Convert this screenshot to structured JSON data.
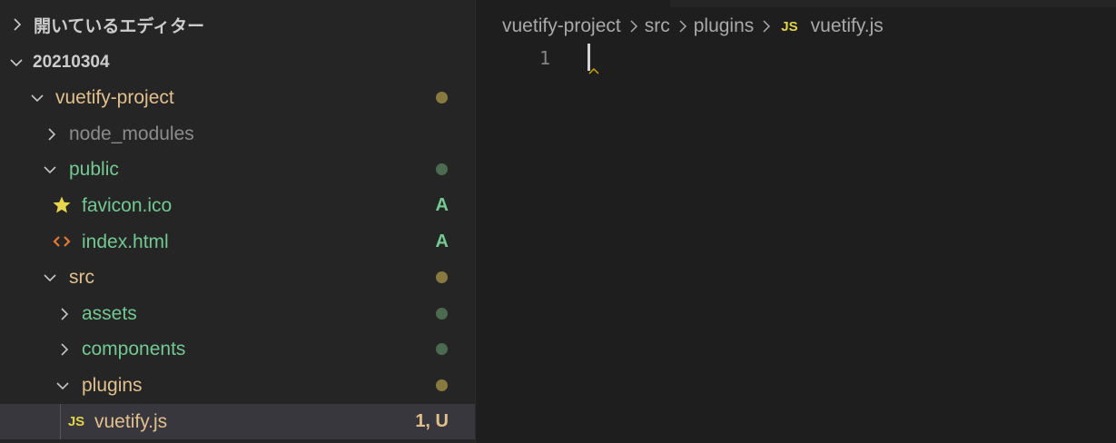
{
  "sidebar": {
    "open_editors_label": "開いているエディター",
    "workspace_label": "20210304",
    "tree": [
      {
        "id": "vuetify-project",
        "label": "vuetify-project",
        "type": "folder",
        "expanded": true,
        "status": "",
        "marker": "dot",
        "color": "#e2c08d",
        "dot_color": "#887a3e"
      },
      {
        "id": "node_modules",
        "label": "node_modules",
        "type": "folder",
        "expanded": false,
        "status": "",
        "marker": "",
        "color": "#8c8c8c",
        "dot_color": ""
      },
      {
        "id": "public",
        "label": "public",
        "type": "folder",
        "expanded": true,
        "status": "",
        "marker": "dot",
        "color": "#73c991",
        "dot_color": "#4b6a4f"
      },
      {
        "id": "favicon",
        "label": "favicon.ico",
        "type": "file",
        "icon": "star-icon",
        "status": "A",
        "marker": "",
        "color": "#73c991",
        "dot_color": ""
      },
      {
        "id": "index",
        "label": "index.html",
        "type": "file",
        "icon": "html-icon",
        "status": "A",
        "marker": "",
        "color": "#73c991",
        "dot_color": ""
      },
      {
        "id": "src",
        "label": "src",
        "type": "folder",
        "expanded": true,
        "status": "",
        "marker": "dot",
        "color": "#e2c08d",
        "dot_color": "#887a3e"
      },
      {
        "id": "assets",
        "label": "assets",
        "type": "folder",
        "expanded": false,
        "status": "",
        "marker": "dot",
        "color": "#73c991",
        "dot_color": "#4b6a4f"
      },
      {
        "id": "components",
        "label": "components",
        "type": "folder",
        "expanded": false,
        "status": "",
        "marker": "dot",
        "color": "#73c991",
        "dot_color": "#4b6a4f"
      },
      {
        "id": "plugins",
        "label": "plugins",
        "type": "folder",
        "expanded": true,
        "status": "",
        "marker": "dot",
        "color": "#e2c08d",
        "dot_color": "#887a3e"
      },
      {
        "id": "vuetify",
        "label": "vuetify.js",
        "type": "file",
        "icon": "js-icon",
        "status": "1, U",
        "marker": "",
        "color": "#e2c08d",
        "dot_color": ""
      }
    ],
    "js_badge": "JS"
  },
  "editor": {
    "breadcrumb": [
      "vuetify-project",
      "src",
      "plugins"
    ],
    "breadcrumb_file": "vuetify.js",
    "breadcrumb_file_badge": "JS",
    "line_numbers": [
      "1"
    ]
  },
  "colors": {
    "sidebar_bg": "#252526",
    "editor_bg": "#1e1e1e",
    "selected_row": "#37373d",
    "modified": "#e2c08d",
    "added": "#73c991",
    "js_badge": "#e1d44a",
    "html_icon": "#e37933",
    "star": "#e8d44d"
  }
}
